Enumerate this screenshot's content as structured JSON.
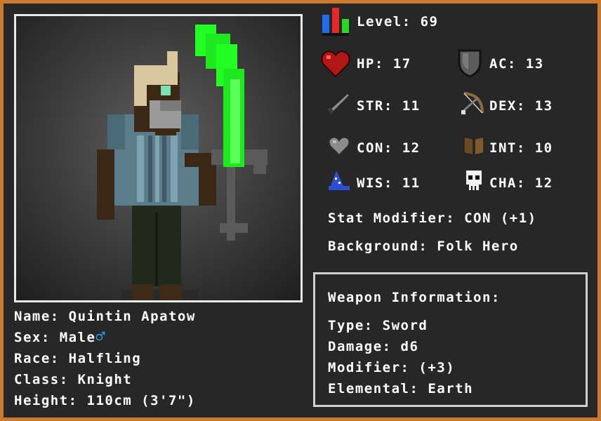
{
  "character": {
    "name_line": "Name: Quintin Apatow",
    "sex_line": "Sex: Male",
    "sex_symbol": "♂",
    "race_line": "Race: Halfling",
    "class_line": "Class: Knight",
    "height_line": "Height: 110cm (3'7\")"
  },
  "stats": {
    "level": "Level: 69",
    "hp": "HP: 17",
    "ac": "AC: 13",
    "str": "STR: 11",
    "dex": "DEX: 13",
    "con": "CON: 12",
    "int": "INT: 10",
    "wis": "WIS: 11",
    "cha": "CHA: 12",
    "stat_modifier": "Stat Modifier: CON (+1)",
    "background": "Background: Folk Hero"
  },
  "weapon": {
    "heading": "Weapon Information:",
    "type": "Type: Sword",
    "damage": "Damage: d6",
    "modifier": "Modifier: (+3)",
    "elemental": "Elemental: Earth"
  },
  "colors": {
    "frame": "#c9782c",
    "panel": "#272727",
    "blade": "#1ee81e",
    "sex_symbol": "#2a9df4"
  },
  "icons": [
    "level-bars-icon",
    "heart-icon",
    "shield-icon",
    "sword-icon",
    "bow-icon",
    "heart-outline-icon",
    "book-icon",
    "wizard-hat-icon",
    "skull-icon"
  ]
}
